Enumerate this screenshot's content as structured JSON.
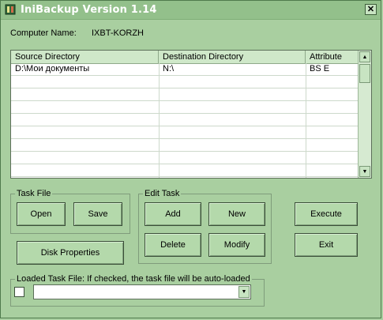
{
  "window": {
    "title": "IniBackup Version 1.14",
    "close_glyph": "✕"
  },
  "computer": {
    "label": "Computer Name:",
    "value": "IXBT-KORZH"
  },
  "table": {
    "columns": [
      "Source Directory",
      "Destination Directory",
      "Attribute"
    ],
    "rows": [
      [
        "D:\\Мои документы",
        "N:\\",
        "BS  E"
      ]
    ]
  },
  "scrollbar": {
    "up_glyph": "▲",
    "down_glyph": "▼"
  },
  "task_file": {
    "group_label": "Task File",
    "open_label": "Open",
    "save_label": "Save"
  },
  "edit_task": {
    "group_label": "Edit Task",
    "add_label": "Add",
    "new_label": "New",
    "delete_label": "Delete",
    "modify_label": "Modify"
  },
  "actions": {
    "execute_label": "Execute",
    "exit_label": "Exit",
    "disk_properties_label": "Disk Properties"
  },
  "loaded_task": {
    "group_label": "Loaded Task File: If checked, the task file will be auto-loaded",
    "checked": false,
    "combo_value": "",
    "dropdown_glyph": "▼"
  },
  "colors": {
    "background": "#a9cfa0",
    "titlebar": "#93c08b",
    "button": "#b4d9ab"
  }
}
